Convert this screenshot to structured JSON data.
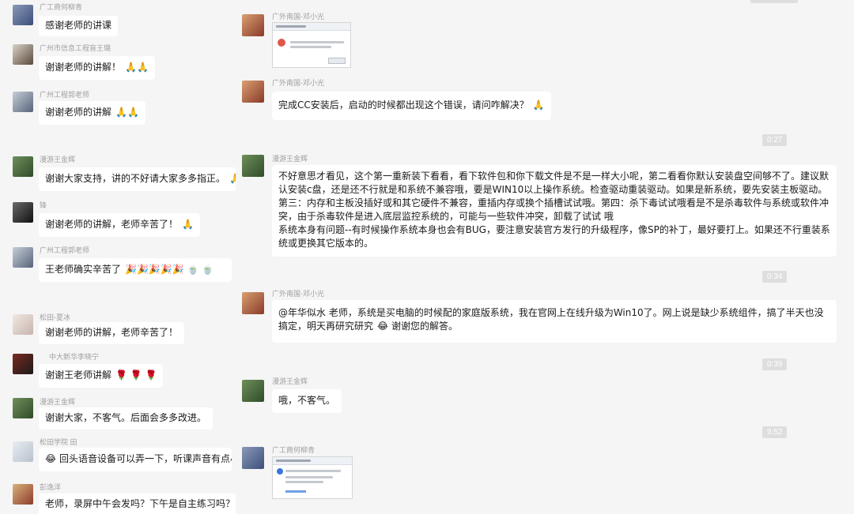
{
  "left": {
    "messages": [
      {
        "sender": "广工商何柳青",
        "text": "感谢老师的讲课"
      },
      {
        "sender": "广州市信息工程盲王璐",
        "text": "谢谢老师的讲解！",
        "emoji": "🙏🙏"
      },
      {
        "sender": "广州工程郭老师",
        "text": "谢谢老师的讲解",
        "emoji": "🙏🙏"
      },
      {
        "sender": "漫游王金辉",
        "text": "谢谢大家支持，讲的不好请大家多多指正。",
        "emoji": "🙏"
      },
      {
        "sender": "锋",
        "text": "谢谢老师的讲解，老师辛苦了！",
        "emoji": "🙏"
      },
      {
        "sender": "广州工程郭老师",
        "text": "王老师确实辛苦了",
        "emoji": "🎉🎉🎉🎉🎉 🍵 🍵"
      },
      {
        "sender": "松田-夏冰",
        "text": "谢谢老师的讲解，老师辛苦了！"
      },
      {
        "sender": "中大新华李晓宁",
        "text": "谢谢王老师讲解",
        "emoji": "🌹 🌹 🌹"
      },
      {
        "sender": "漫游王金辉",
        "text": "谢谢大家，不客气。后面会多多改进。"
      },
      {
        "sender": "松田学院 田",
        "text": "回头语音设备可以弄一下，听课声音有点小",
        "lead_emoji": "😂"
      },
      {
        "sender": "彭逸洋",
        "text": "老师，录屏中午会发吗？下午是自主练习吗？"
      }
    ]
  },
  "right": {
    "messages": [
      {
        "sender": "广外南国-邓小光",
        "kind": "screenshot"
      },
      {
        "sender": "广外南国-邓小光",
        "text": "完成CC安装后，启动的时候都出现这个错误，请问咋解决？",
        "emoji": "🙏"
      },
      {
        "time": "0:27"
      },
      {
        "sender": "漫游王金辉",
        "text": "不好意思才看见，这个第一重新装下看看，看下软件包和你下载文件是不是一样大小呢，第二看看你默认安装盘空间够不了。建议默认安装c盘，还是还不行就是和系统不兼容哦，要是WIN10以上操作系统。检查驱动重装驱动。如果是新系统，要先安装主板驱动。第三：内存和主板没插好或和其它硬件不兼容，重插内存或换个插槽试试哦。第四：杀下毒试试哦看是不是杀毒软件与系统或软件冲突，由于杀毒软件是进入底层监控系统的，可能与一些软件冲突，卸载了试试 哦",
        "text2": "系统本身有问题--有时候操作系统本身也会有BUG，要注意安装官方发行的升级程序，像SP的补丁，最好要打上。如果还不行重装系统或更换其它版本的。"
      },
      {
        "time": "0:34"
      },
      {
        "sender": "广外南国-邓小光",
        "text": "@年华似水 老师，系统是买电脑的时候配的家庭版系统，我在官网上在线升级为Win10了。网上说是缺少系统组件，搞了半天也没搞定，明天再研究研究",
        "emoji": "😂",
        "tail": "谢谢您的解答。"
      },
      {
        "time": "0:39"
      },
      {
        "sender": "漫游王金辉",
        "text": "哦，不客气。"
      },
      {
        "time": "9:52"
      },
      {
        "sender": "广工商何柳青",
        "kind": "screenshot"
      }
    ]
  }
}
